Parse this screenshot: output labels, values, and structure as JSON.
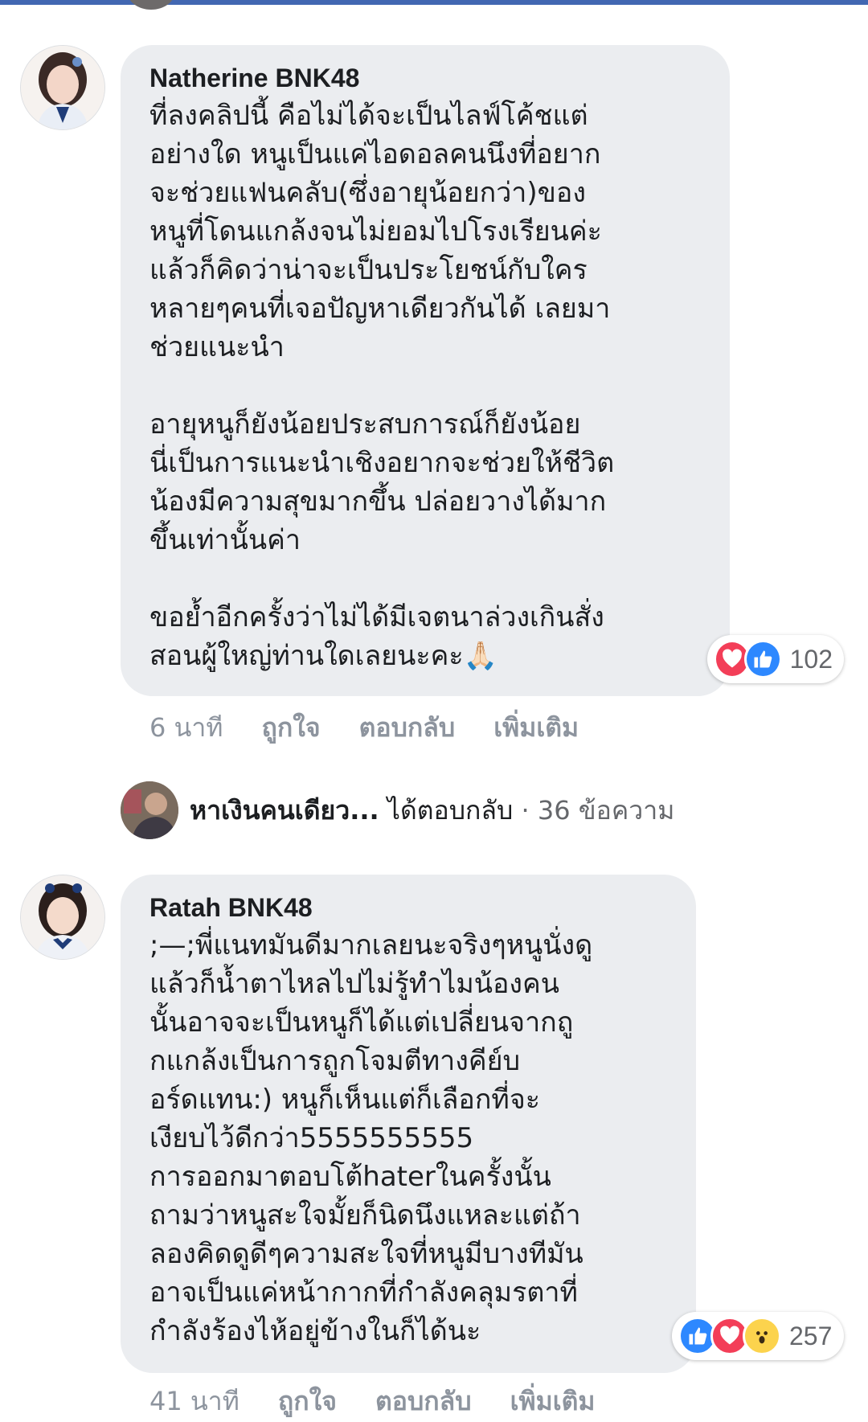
{
  "colors": {
    "brand": "#4267b2",
    "bubble": "#ebedf0",
    "like": "#2d88ff",
    "love": "#f33e58",
    "wow": "#fcd34d"
  },
  "comments": [
    {
      "author": "Natherine BNK48",
      "text": "ที่ลงคลิปนี้ คือไม่ได้จะเป็นไลฟ์โค้ชแต่\nอย่างใด หนูเป็นแค่ไอดอลคนนึงที่อยาก\nจะช่วยแฟนคลับ(ซึ่งอายุน้อยกว่า)ของ\nหนูที่โดนแกล้งจนไม่ยอมไปโรงเรียนค่ะ\nแล้วก็คิดว่าน่าจะเป็นประโยชน์กับใคร\nหลายๆคนที่เจอปัญหาเดียวกันได้ เลยมา\nช่วยแนะนำ\n\nอายุหนูก็ยังน้อยประสบการณ์ก็ยังน้อย\nนี่เป็นการแนะนำเชิงอยากจะช่วยให้ชีวิต\nน้องมีความสุขมากขึ้น ปล่อยวางได้มาก\nขึ้นเท่านั้นค่า\n\nขอย้ำอีกครั้งว่าไม่ได้มีเจตนาล่วงเกินสั่ง\nสอนผู้ใหญ่ท่านใดเลยนะคะ🙏🏻",
      "reactions": [
        "love",
        "like"
      ],
      "reaction_count": "102",
      "time": "6 นาที",
      "like_label": "ถูกใจ",
      "reply_label": "ตอบกลับ",
      "more_label": "เพิ่มเติม"
    },
    {
      "author": "Ratah BNK48",
      "text": ";—;พี่แนทมันดีมากเลยนะจริงๆหนูนั่งดู\nแล้วก็น้ำตาไหลไปไม่รู้ทำไมน้องคน\nนั้นอาจจะเป็นหนูก็ได้แต่เปลี่ยนจากถู\nกแกล้งเป็นการถูกโจมตีทางคีย์บ\nอร์ดแทน:) หนูก็เห็นแต่ก็เลือกที่จะ\nเงียบไว้ดีกว่า5555555555\nการออกมาตอบโต้haterในครั้งนั้น\nถามว่าหนูสะใจมั้ยก็นิดนึงแหละแต่ถ้า\nลองคิดดูดีๆความสะใจที่หนูมีบางทีมัน\nอาจเป็นแค่หน้ากากที่กำลังคลุมรตาที่\nกำลังร้องไห้อยู่ข้างในก็ได้นะ",
      "reactions": [
        "like",
        "love",
        "wow"
      ],
      "reaction_count": "257",
      "time": "41 นาที",
      "like_label": "ถูกใจ",
      "reply_label": "ตอบกลับ",
      "more_label": "เพิ่มเติม"
    }
  ],
  "reply_summary": {
    "name": "หาเงินคนเดียว...",
    "action": " ได้ตอบกลับ",
    "count": " · 36 ข้อความ"
  }
}
